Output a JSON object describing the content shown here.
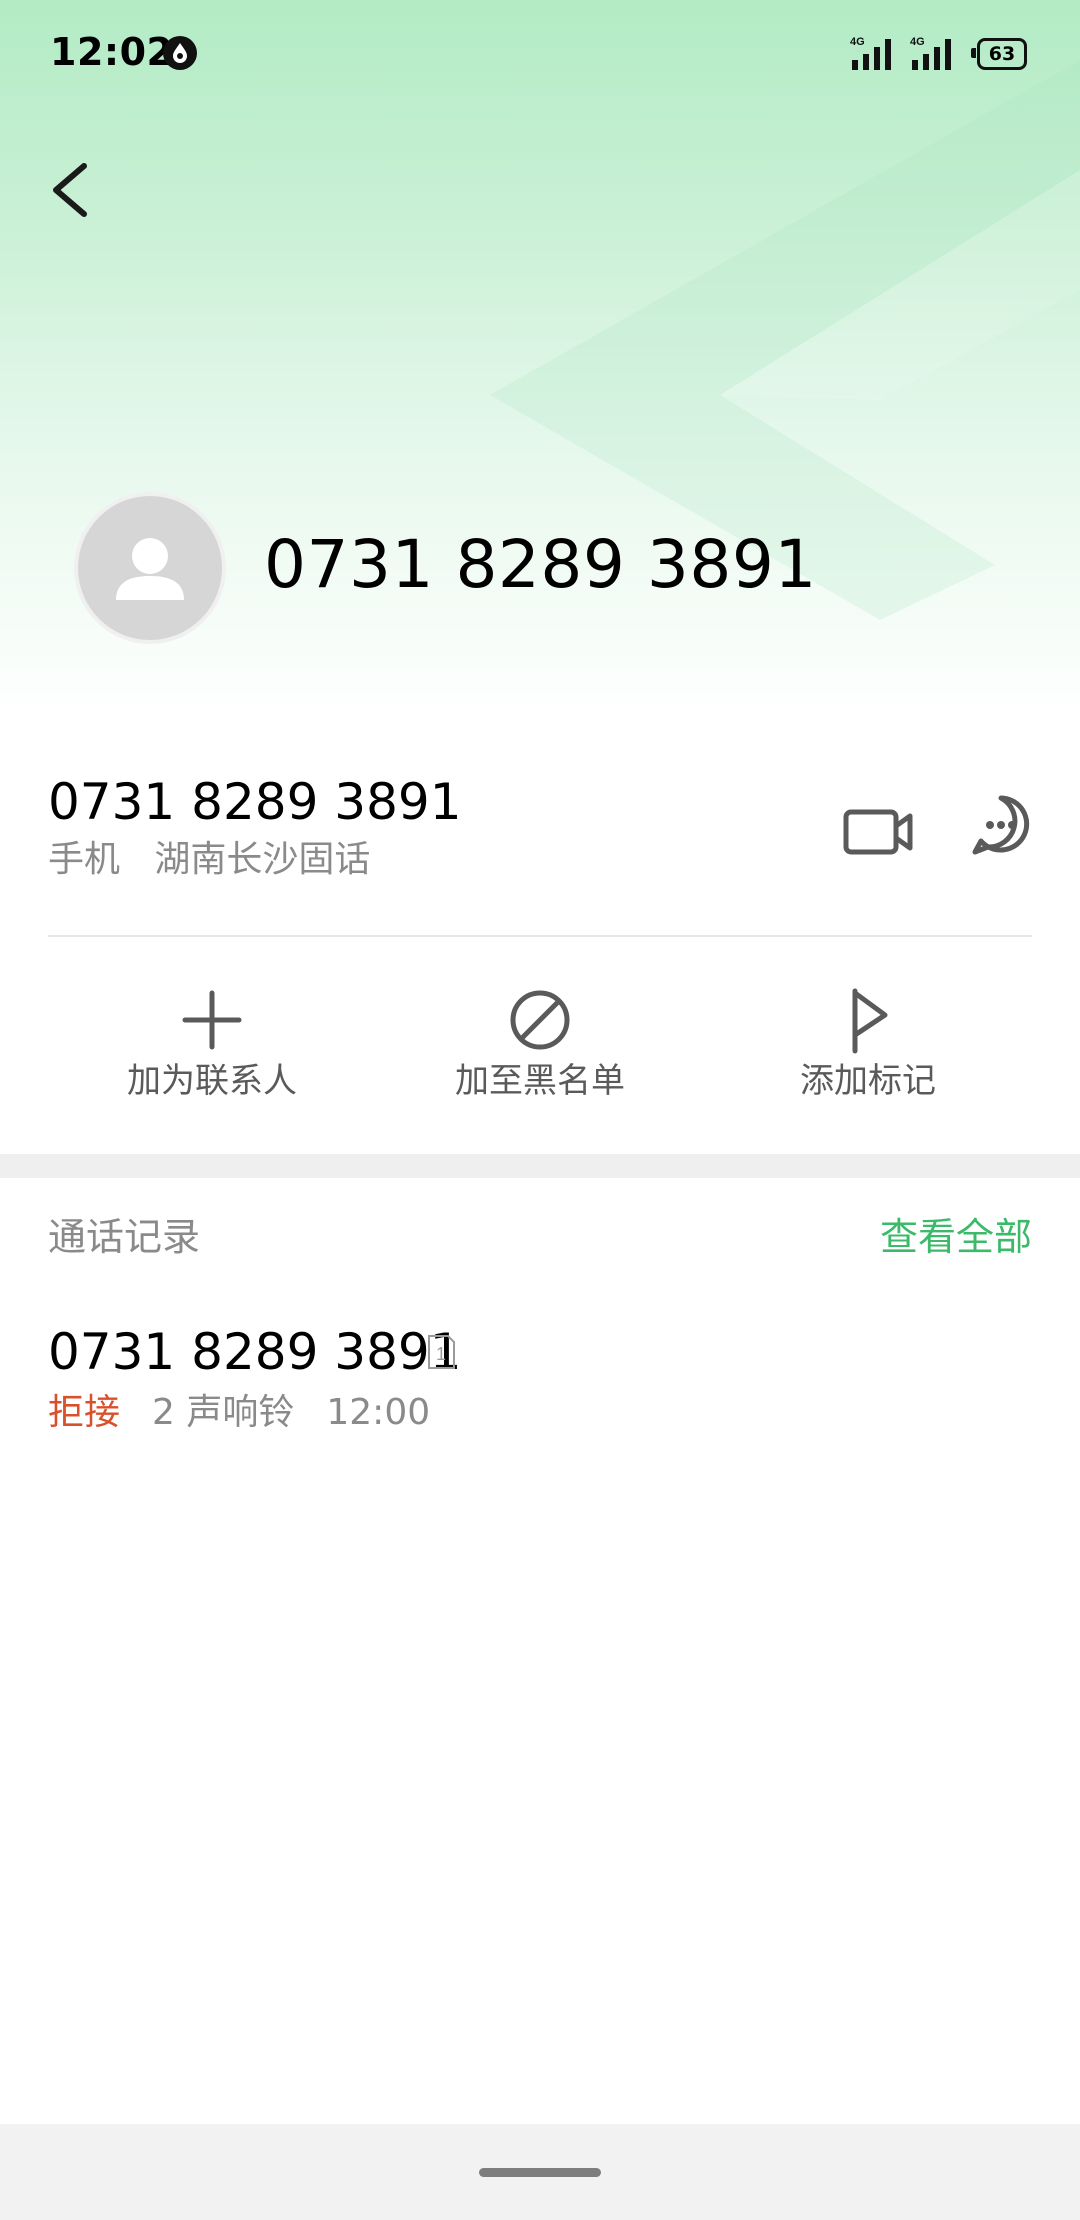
{
  "status_bar": {
    "time": "12:02",
    "app_icon": "notification-droplet-icon",
    "signal_1_label": "4G",
    "signal_2_label": "4G",
    "battery_level": "63"
  },
  "header": {
    "back_icon": "chevron-left-icon",
    "avatar_icon": "person-avatar-icon",
    "number": "0731 8289 3891"
  },
  "number_detail": {
    "number": "0731 8289 3891",
    "sub_text": "手机   湖南长沙固话",
    "video_icon": "video-call-icon",
    "message_icon": "message-bubble-icon"
  },
  "actions": [
    {
      "label": "加为联系人",
      "icon": "plus-icon"
    },
    {
      "label": "加至黑名单",
      "icon": "block-icon"
    },
    {
      "label": "添加标记",
      "icon": "flag-icon"
    }
  ],
  "call_history": {
    "title": "通话记录",
    "view_all": "查看全部",
    "records": [
      {
        "number": "0731 8289 3891",
        "sim_label": "1",
        "status": "拒接",
        "detail": "2 声响铃",
        "time": "12:00"
      }
    ]
  },
  "colors": {
    "accent_green": "#3cba6a",
    "rejected_red": "#d9512c",
    "secondary_text": "#8a8a8a",
    "hero_green": "#b3ebc5"
  }
}
